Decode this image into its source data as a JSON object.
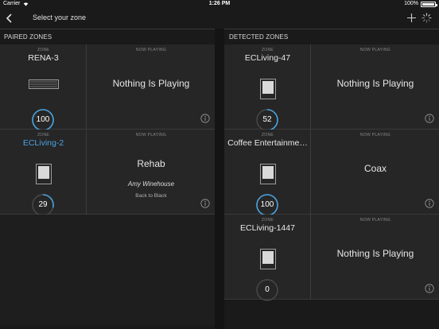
{
  "status": {
    "carrier": "Carrier",
    "time": "1:26 PM",
    "battery": "100%"
  },
  "nav": {
    "title": "Select your zone"
  },
  "paired": {
    "header": "PAIRED ZONES",
    "zones": [
      {
        "zone_caption": "ZONE",
        "name": "RENA-3",
        "device": "soundbar",
        "volume": "100",
        "volume_level": 1.0,
        "np_caption": "NOW PLAYING",
        "now_playing": "Nothing Is Playing"
      },
      {
        "zone_caption": "ZONE",
        "name": "ECLiving-2",
        "selected": true,
        "device": "speaker",
        "volume": "29",
        "volume_level": 0.29,
        "np_caption": "NOW PLAYING",
        "track": "Rehab",
        "artist": "Amy Winehouse",
        "album": "Back to Black"
      }
    ]
  },
  "detected": {
    "header": "DETECTED ZONES",
    "zones": [
      {
        "zone_caption": "ZONE",
        "name": "ECLiving-47",
        "device": "speaker",
        "volume": "52",
        "volume_level": 0.52,
        "np_caption": "NOW PLAYING",
        "now_playing": "Nothing Is Playing"
      },
      {
        "zone_caption": "ZONE",
        "name": "Coffee Entertainme…",
        "device": "speaker",
        "volume": "100",
        "volume_level": 1.0,
        "np_caption": "NOW PLAYING",
        "now_playing": "Coax"
      },
      {
        "zone_caption": "ZONE",
        "name": "ECLiving-1447",
        "device": "speaker",
        "volume": "0",
        "volume_level": 0.0,
        "np_caption": "NOW PLAYING",
        "now_playing": "Nothing Is Playing"
      }
    ]
  },
  "colors": {
    "accent": "#4aa3e0",
    "ring_track": "#4a4a4a",
    "background": "#1a1a1a",
    "card": "#262626"
  }
}
